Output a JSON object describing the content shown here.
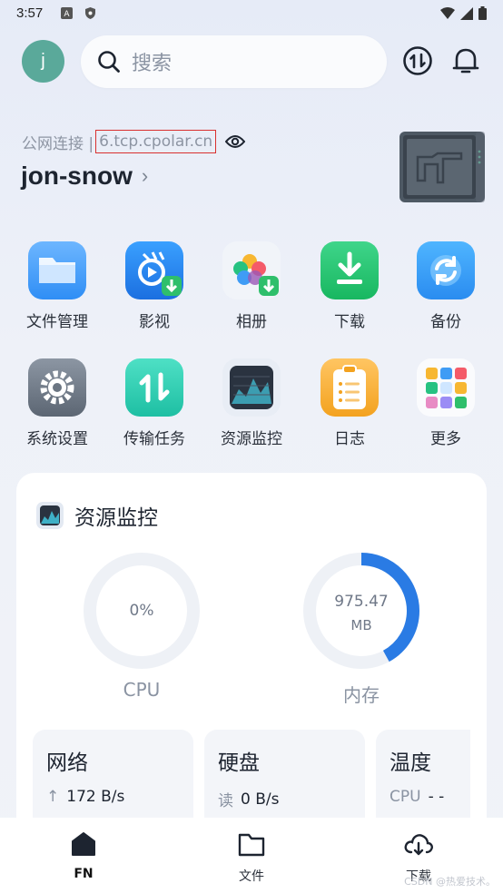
{
  "status_bar": {
    "time": "3:57"
  },
  "header": {
    "avatar_letter": "j",
    "search_placeholder": "搜索"
  },
  "server": {
    "network_label": "公网连接 |",
    "host": "6.tcp.cpolar.cn",
    "device_name": "jon-snow",
    "chevron": "›"
  },
  "apps": [
    {
      "label": "文件管理",
      "icon": "folder-icon"
    },
    {
      "label": "影视",
      "icon": "video-icon"
    },
    {
      "label": "相册",
      "icon": "photos-icon"
    },
    {
      "label": "下载",
      "icon": "download-icon"
    },
    {
      "label": "备份",
      "icon": "backup-icon"
    },
    {
      "label": "系统设置",
      "icon": "settings-icon"
    },
    {
      "label": "传输任务",
      "icon": "transfer-icon"
    },
    {
      "label": "资源监控",
      "icon": "monitor-icon"
    },
    {
      "label": "日志",
      "icon": "log-icon"
    },
    {
      "label": "更多",
      "icon": "more-icon"
    }
  ],
  "resource_card": {
    "title": "资源监控",
    "cpu": {
      "value": "0%",
      "label": "CPU",
      "fraction": 0
    },
    "memory": {
      "value": "975.47",
      "unit": "MB",
      "label": "内存",
      "fraction": 0.42
    },
    "network": {
      "title": "网络",
      "arrow": "↑",
      "value": "172 B/s"
    },
    "disk": {
      "title": "硬盘",
      "key": "读",
      "value": "0 B/s"
    },
    "temperature": {
      "title": "温度",
      "key": "CPU",
      "value": "- -"
    }
  },
  "bottom_nav": [
    {
      "label": "FN",
      "icon": "home-icon",
      "active": true
    },
    {
      "label": "文件",
      "icon": "folder-outline-icon",
      "active": false
    },
    {
      "label": "下载",
      "icon": "cloud-download-icon",
      "active": false
    }
  ],
  "watermark": "CSDN @热爱技术。",
  "colors": {
    "accent": "#2a7be4",
    "avatar": "#5aa99a",
    "highlight_border": "#d9302f"
  }
}
